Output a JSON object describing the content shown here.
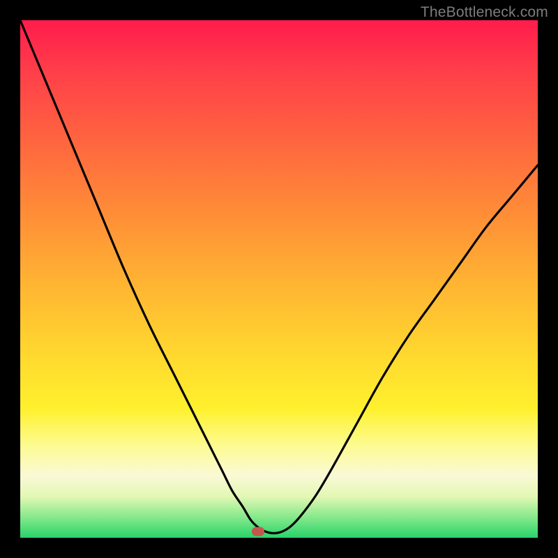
{
  "watermark": "TheBottleneck.com",
  "chart_data": {
    "type": "line",
    "title": "",
    "xlabel": "",
    "ylabel": "",
    "xlim": [
      0,
      100
    ],
    "ylim": [
      0,
      100
    ],
    "grid": false,
    "legend": false,
    "series": [
      {
        "name": "bottleneck-curve",
        "x": [
          0,
          5,
          10,
          15,
          20,
          25,
          30,
          33,
          36,
          39,
          41,
          43,
          44.5,
          46,
          48,
          50,
          52,
          54,
          57,
          60,
          65,
          70,
          75,
          80,
          85,
          90,
          95,
          100
        ],
        "y": [
          100,
          88,
          76,
          64,
          52,
          41,
          31,
          25,
          19,
          13,
          9,
          6,
          3.5,
          2,
          1,
          1,
          2,
          4,
          8,
          13,
          22,
          31,
          39,
          46,
          53,
          60,
          66,
          72
        ]
      }
    ],
    "annotations": [
      {
        "name": "optimal-marker",
        "x": 46,
        "y": 1.2,
        "color": "#c0584e"
      }
    ],
    "background_gradient": {
      "top": "#ff1c4d",
      "bottom": "#28d36b"
    }
  }
}
